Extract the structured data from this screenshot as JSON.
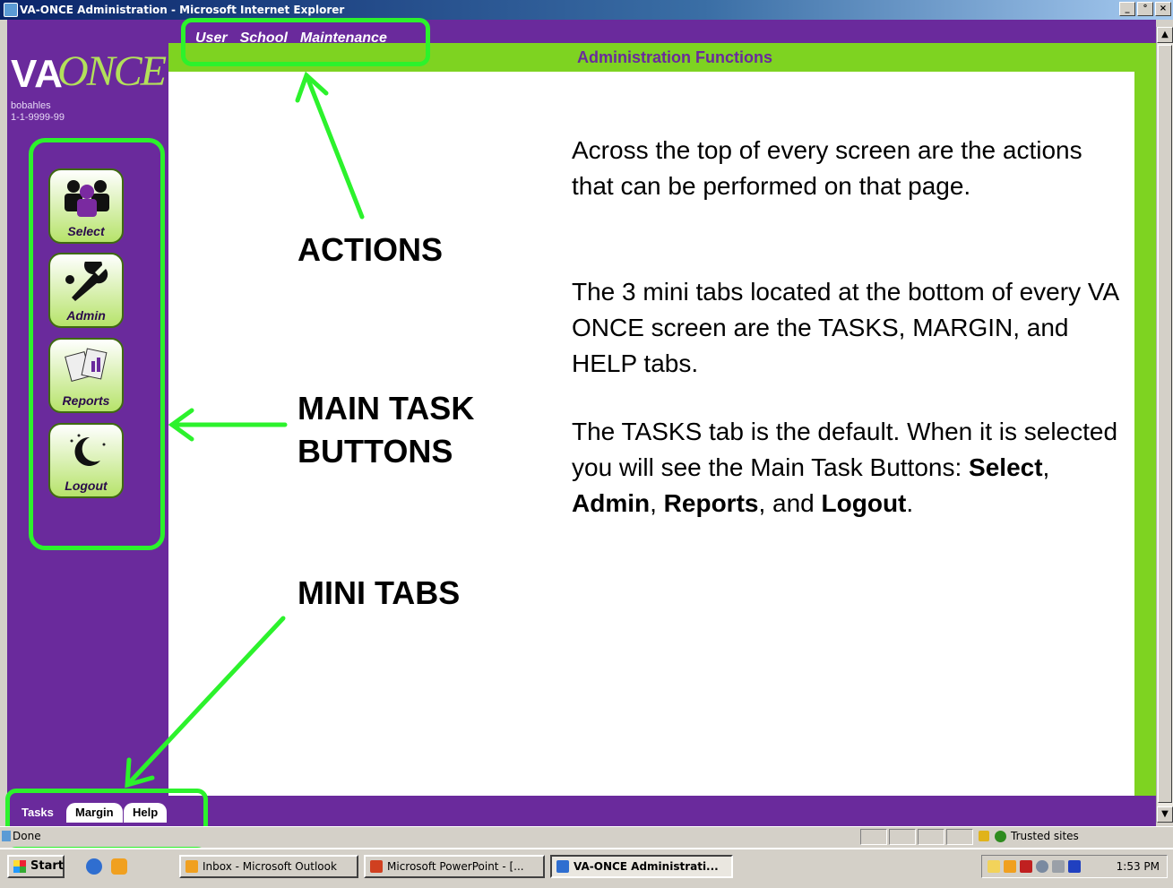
{
  "window": {
    "title": "VA-ONCE Administration - Microsoft Internet Explorer",
    "buttons": [
      "_",
      "°",
      "×"
    ]
  },
  "app": {
    "logo": {
      "va": "VA",
      "once": "ONCE"
    },
    "user": {
      "name": "bobahles",
      "id": "1-1-9999-99"
    },
    "actions": [
      "User",
      "School",
      "Maintenance"
    ],
    "page_title": "Administration Functions",
    "task_buttons": [
      {
        "label": "Select",
        "icon": "users-icon"
      },
      {
        "label": "Admin",
        "icon": "wrench-icon"
      },
      {
        "label": "Reports",
        "icon": "reports-icon"
      },
      {
        "label": "Logout",
        "icon": "moon-icon"
      }
    ],
    "mini_tabs": [
      {
        "label": "Tasks",
        "active": true
      },
      {
        "label": "Margin",
        "active": false
      },
      {
        "label": "Help",
        "active": false
      }
    ]
  },
  "annotations": {
    "actions": "ACTIONS",
    "main_task_buttons_1": "MAIN TASK",
    "main_task_buttons_2": "BUTTONS",
    "mini_tabs": "MINI TABS",
    "para1": "Across the top of every screen are the actions that can be performed on that page.",
    "para2": "The 3 mini tabs located at the bottom of every VA ONCE screen are the TASKS, MARGIN, and HELP tabs.",
    "para3_a": "The TASKS tab is the default. When it is selected you will see the Main Task Buttons: ",
    "para3_select": "Select",
    "para3_sep1": ", ",
    "para3_admin": "Admin",
    "para3_sep2": ", ",
    "para3_reports": "Reports",
    "para3_sep3": ", and ",
    "para3_logout": "Logout",
    "para3_end": "."
  },
  "statusbar": {
    "status": "Done",
    "zone": "Trusted sites"
  },
  "taskbar": {
    "start": "Start",
    "items": [
      {
        "label": "Inbox - Microsoft Outlook",
        "active": false
      },
      {
        "label": "Microsoft PowerPoint - [...",
        "active": false
      },
      {
        "label": "VA-ONCE Administrati...",
        "active": true
      }
    ],
    "clock": "1:53 PM"
  },
  "colors": {
    "purple": "#6a2a9c",
    "green_frame": "#7ed321",
    "highlight": "#2cf22c"
  }
}
